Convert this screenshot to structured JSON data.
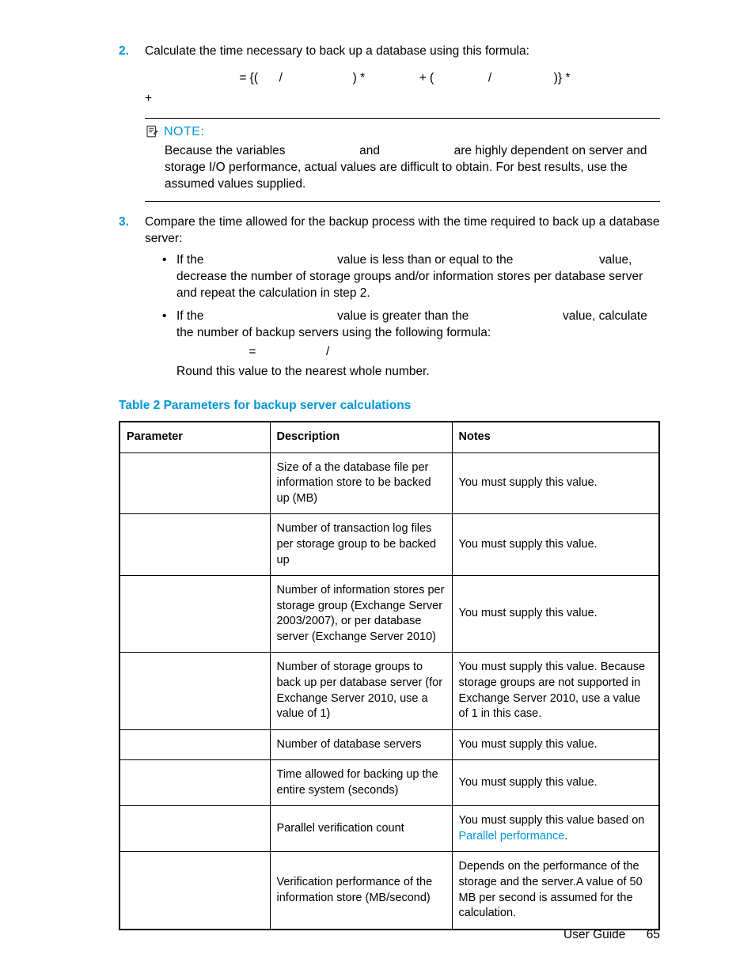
{
  "steps": {
    "s2": {
      "num": "2.",
      "text": "Calculate the time necessary to back up a database using this formula:"
    },
    "s3": {
      "num": "3.",
      "text": "Compare the time allowed for the backup process with the time required to back up a database server:",
      "b1a": "If the ",
      "b1b": " value is less than or equal to the ",
      "b1c": " value, decrease the number of storage groups and/or information stores per database server and repeat the calculation in step 2.",
      "b2a": "If the ",
      "b2b": " value is greater than the ",
      "b2c": " value, calculate the number of backup servers using the following formula:",
      "round": "Round this value to the nearest whole number."
    }
  },
  "formula": {
    "eq": " = {(",
    "slash1": "   /  ",
    "close1": ") * ",
    "plus_open": " + (",
    "slash2": "   /  ",
    "close2": ")} * ",
    "line2_plus": "+ "
  },
  "subformula": {
    "eq": " = ",
    "slash": "   /  "
  },
  "note": {
    "label": "NOTE:",
    "b1": "Because the variables ",
    "b2": " and ",
    "b3": " are highly dependent on server and storage I/O performance, actual values are difficult to obtain. For best results, use the assumed values supplied."
  },
  "table": {
    "caption": "Table 2 Parameters for backup server calculations",
    "h1": "Parameter",
    "h2": "Description",
    "h3": "Notes",
    "rows": [
      {
        "p": "",
        "d": "Size of a the database file per information store to be backed up (MB)",
        "n": "You must supply this value."
      },
      {
        "p": "",
        "d": "Number of transaction log files per storage group to be backed up",
        "n": "You must supply this value."
      },
      {
        "p": "",
        "d": "Number of information stores per storage group (Exchange Server 2003/2007), or per database server (Exchange Server 2010)",
        "n": "You must supply this value."
      },
      {
        "p": "",
        "d": "Number of storage groups to back up per database server (for Exchange Server 2010, use a value of 1)",
        "n": "You must supply this value. Because storage groups are not supported in Exchange Server 2010, use a value of 1 in this case."
      },
      {
        "p": "",
        "d": "Number of database servers",
        "n": "You must supply this value."
      },
      {
        "p": "",
        "d": "Time allowed for backing up the entire system (seconds)",
        "n": "You must supply this value."
      },
      {
        "p": "",
        "d": "Parallel verification count",
        "n_pre": "You must supply this value based on ",
        "n_link": "Parallel performance",
        "n_post": "."
      },
      {
        "p": "",
        "d": "Verification performance of the information store (MB/second)",
        "n": "Depends on the performance of the storage and the server.A value of 50 MB per second is assumed for the calculation."
      }
    ]
  },
  "footer": {
    "title": "User Guide",
    "page": "65"
  }
}
